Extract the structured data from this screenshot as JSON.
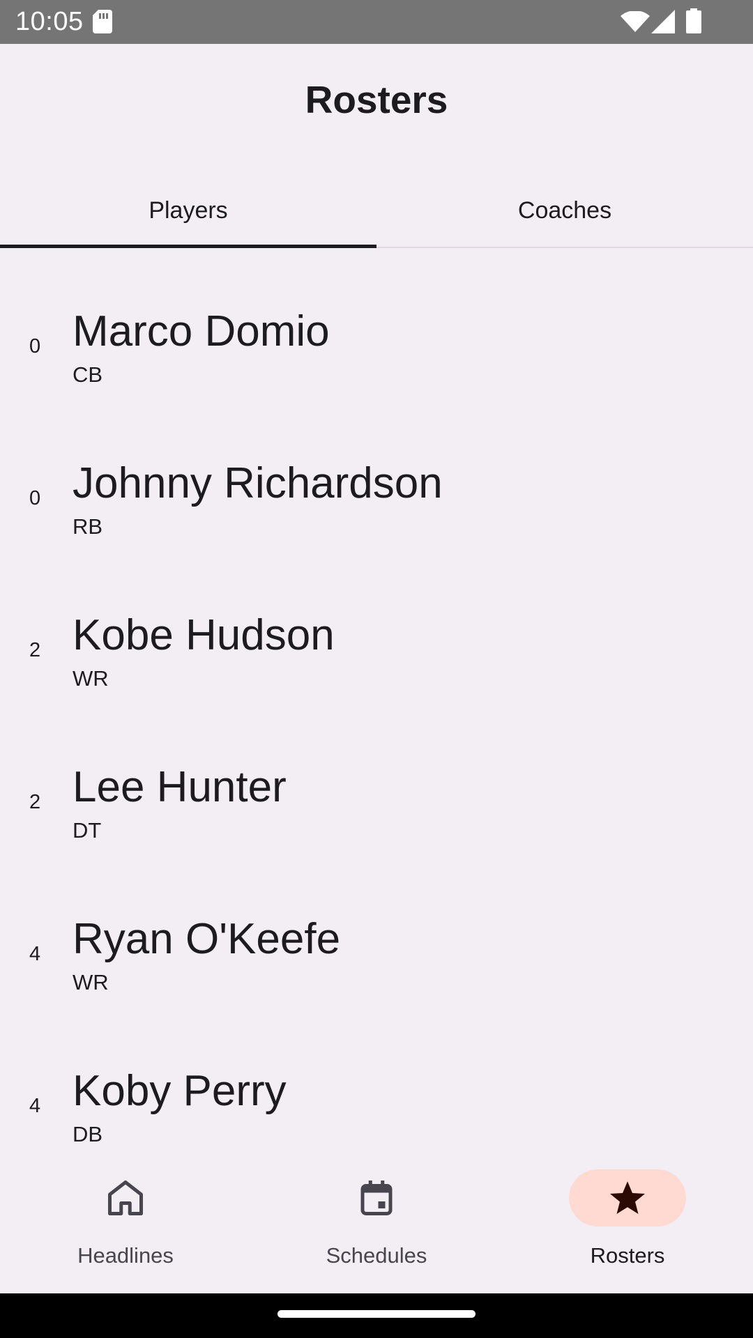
{
  "status_bar": {
    "time": "10:05",
    "icons": [
      "sd-card-icon",
      "wifi-icon",
      "signal-icon",
      "battery-icon"
    ]
  },
  "header": {
    "title": "Rosters"
  },
  "tabs": [
    {
      "label": "Players",
      "selected": true
    },
    {
      "label": "Coaches",
      "selected": false
    }
  ],
  "players": [
    {
      "number": "0",
      "name": "Marco Domio",
      "position": "CB"
    },
    {
      "number": "0",
      "name": "Johnny Richardson",
      "position": "RB"
    },
    {
      "number": "2",
      "name": "Kobe Hudson",
      "position": "WR"
    },
    {
      "number": "2",
      "name": "Lee Hunter",
      "position": "DT"
    },
    {
      "number": "4",
      "name": "Ryan O'Keefe",
      "position": "WR"
    },
    {
      "number": "4",
      "name": "Koby Perry",
      "position": "DB"
    }
  ],
  "bottom_nav": {
    "items": [
      {
        "label": "Headlines",
        "icon": "home-icon",
        "selected": false
      },
      {
        "label": "Schedules",
        "icon": "calendar-icon",
        "selected": false
      },
      {
        "label": "Rosters",
        "icon": "star-icon",
        "selected": true
      }
    ]
  },
  "colors": {
    "background": "#f3eef4",
    "status_bar": "#757575",
    "active_pill": "#ffdad2",
    "text": "#1d1b20",
    "muted_text": "#49454f"
  }
}
